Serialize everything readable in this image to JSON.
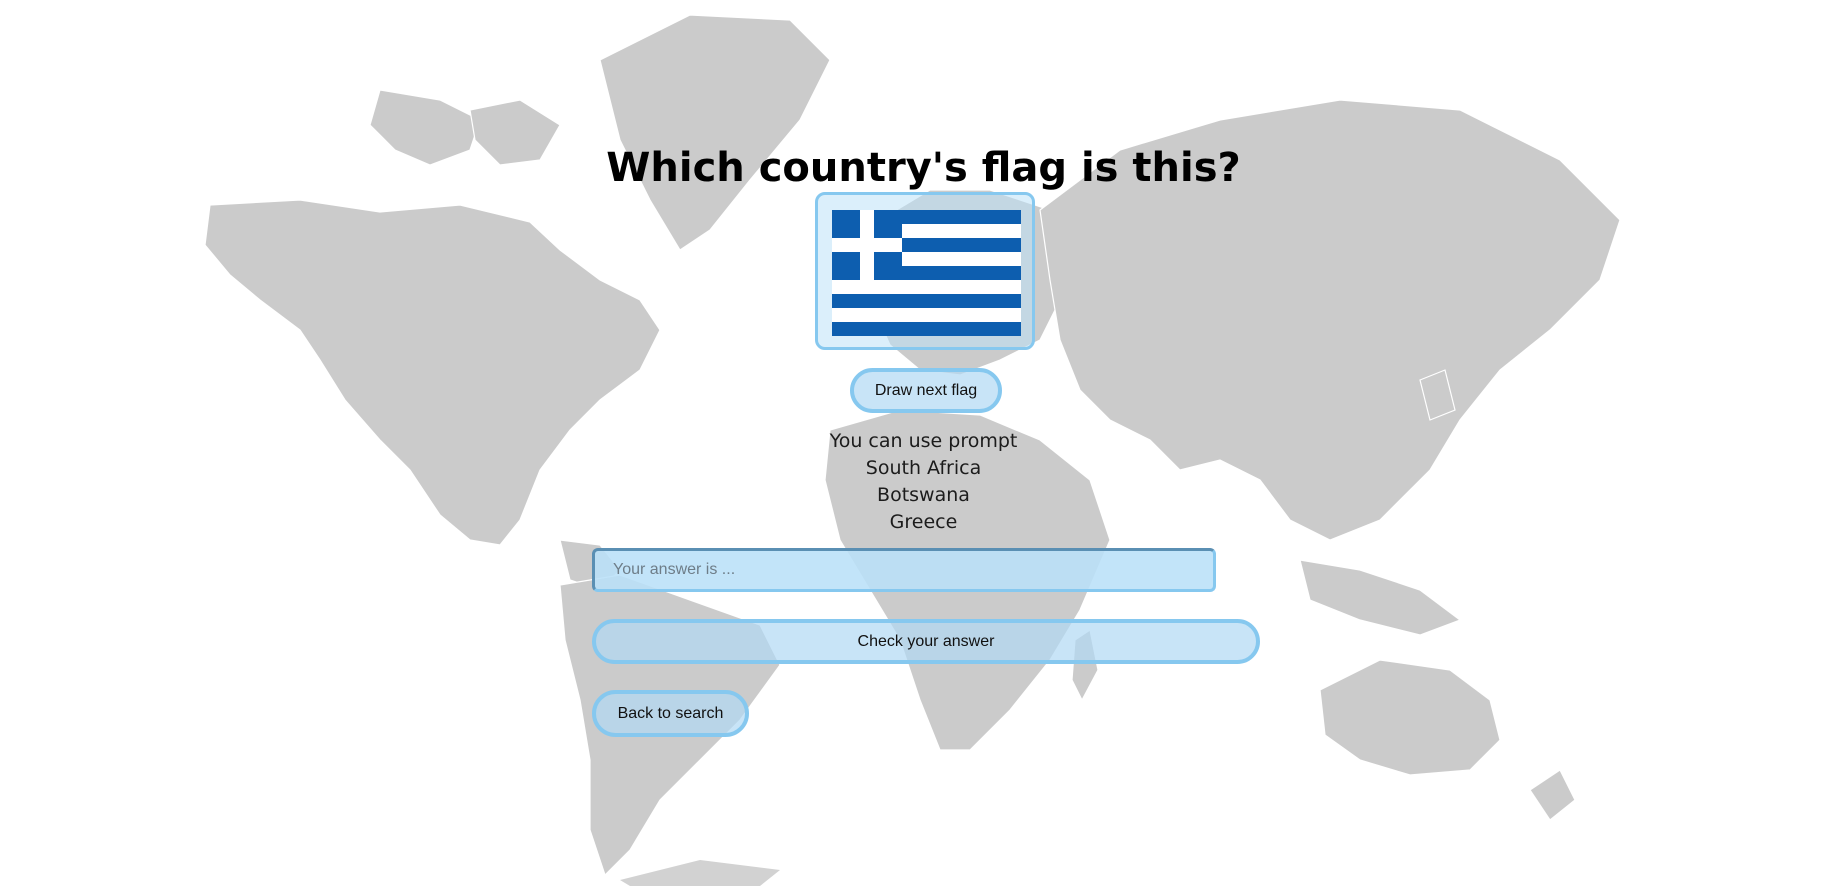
{
  "page": {
    "title": "Which country's flag is this?"
  },
  "flag": {
    "icon": "greece-flag",
    "colors": {
      "blue": "#0d5eaf",
      "white": "#ffffff"
    }
  },
  "buttons": {
    "draw_next": "Draw next flag",
    "check_answer": "Check your answer",
    "back_to_search": "Back to search"
  },
  "prompt": {
    "heading": "You can use prompt",
    "options": [
      "South Africa",
      "Botswana",
      "Greece"
    ]
  },
  "answer_input": {
    "value": "",
    "placeholder": "Your answer is ..."
  },
  "theme": {
    "accent": "#86c8ef",
    "button_fill": "#b0d8f4",
    "map_land": "#cbcbcb"
  }
}
